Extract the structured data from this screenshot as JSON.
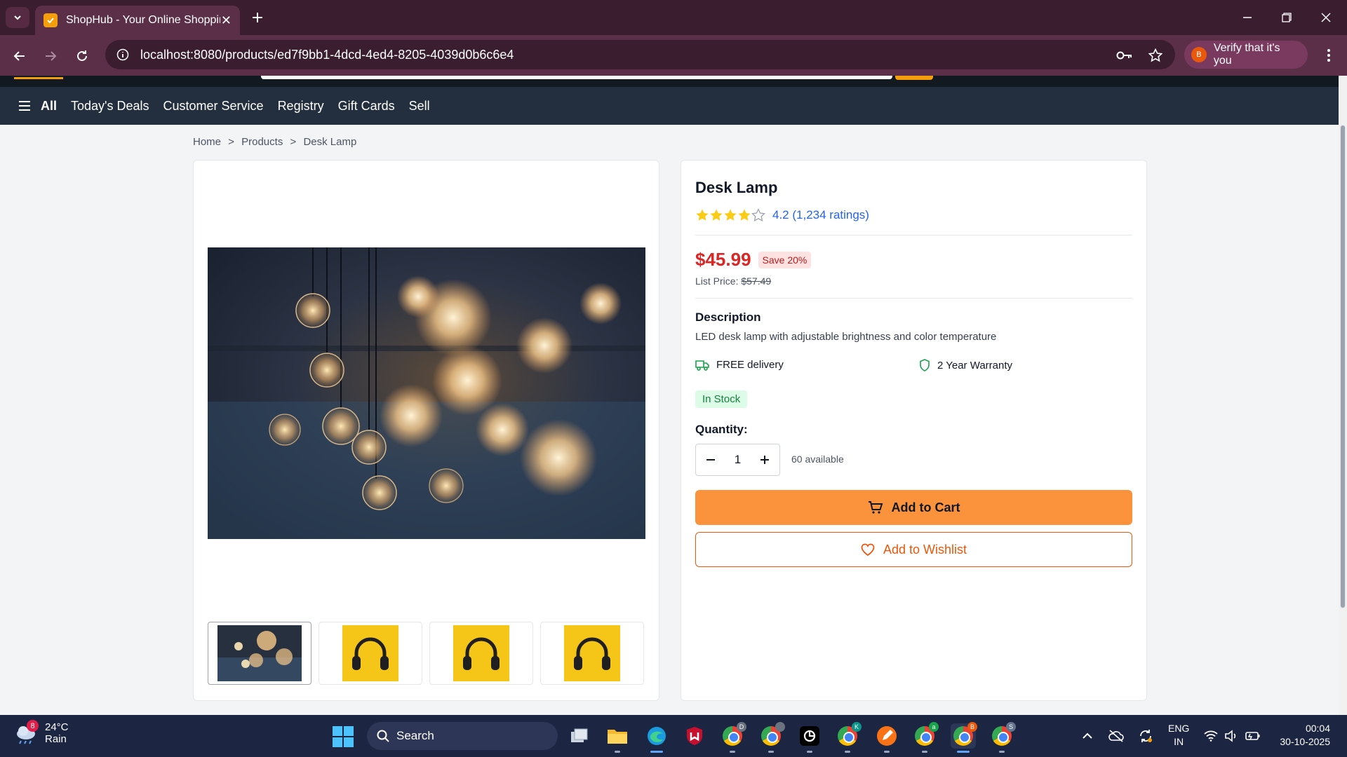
{
  "browser": {
    "tab_title": "ShopHub - Your Online Shopping",
    "url": "localhost:8080/products/ed7f9bb1-4dcd-4ed4-8205-4039d0b6c6e4",
    "profile_label": "Verify that it's you",
    "profile_initial": "B"
  },
  "subnav": {
    "all_label": "All",
    "items": [
      "Today's Deals",
      "Customer Service",
      "Registry",
      "Gift Cards",
      "Sell"
    ]
  },
  "breadcrumb": [
    "Home",
    ">",
    "Products",
    ">",
    "Desk Lamp"
  ],
  "product": {
    "title": "Desk Lamp",
    "rating": 4.2,
    "rating_text": "4.2 (1,234 ratings)",
    "price": "$45.99",
    "save_badge": "Save 20%",
    "list_price_label": "List Price:",
    "list_price": "$57.49",
    "description_heading": "Description",
    "description": "LED desk lamp with adjustable brightness and color temperature",
    "delivery": "FREE delivery",
    "warranty": "2 Year Warranty",
    "stock": "In Stock",
    "quantity_label": "Quantity:",
    "quantity": "1",
    "available": "60 available",
    "add_to_cart": "Add to Cart",
    "add_to_wishlist": "Add to Wishlist"
  },
  "gallery": {
    "thumbnails": [
      "pendant-bulbs",
      "headphones",
      "headphones",
      "headphones"
    ]
  },
  "taskbar": {
    "weather_badge": "8",
    "temperature": "24°C",
    "condition": "Rain",
    "search_label": "Search",
    "lang_top": "ENG",
    "lang_bottom": "IN",
    "time": "00:04",
    "date": "30-10-2025",
    "chrome_badges": [
      "D",
      "",
      "K",
      "",
      "a",
      "B",
      "S"
    ]
  },
  "colors": {
    "accent": "#fb923c",
    "price": "#dc2626",
    "link": "#2563eb",
    "browser_frame": "#5c2f48",
    "nav": "#232f3e"
  }
}
